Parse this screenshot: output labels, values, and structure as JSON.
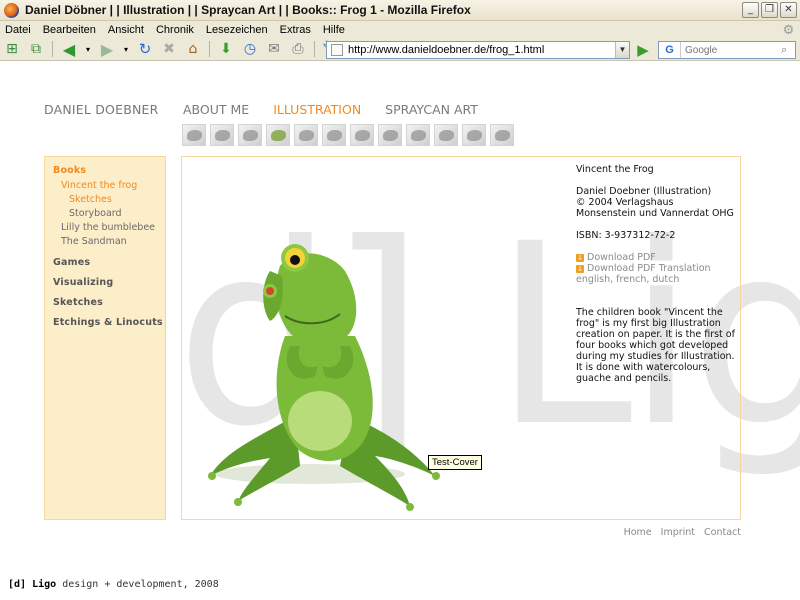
{
  "window": {
    "title": "Daniel Döbner | | Illustration | | Spraycan Art | | Books:: Frog 1 - Mozilla Firefox",
    "buttons": [
      "_",
      "❐",
      "✕"
    ]
  },
  "menu": [
    "Datei",
    "Bearbeiten",
    "Ansicht",
    "Chronik",
    "Lesezeichen",
    "Extras",
    "Hilfe"
  ],
  "toolbar": {
    "url": "http://www.danieldoebner.de/frog_1.html",
    "search_placeholder": "Google",
    "search_engine": "G"
  },
  "site": {
    "logo": "DANIEL DOEBNER",
    "nav": [
      {
        "label": "ABOUT ME",
        "active": false
      },
      {
        "label": "ILLUSTRATION",
        "active": true
      },
      {
        "label": "SPRAYCAN ART",
        "active": false
      }
    ],
    "watermark": "[d] Ligo"
  },
  "sidebar": {
    "books": "Books",
    "vincent": "Vincent the frog",
    "sketches": "Sketches",
    "storyboard": "Storyboard",
    "lilly": "Lilly the bumblebee",
    "sandman": "The Sandman",
    "games": "Games",
    "visualizing": "Visualizing",
    "sketches_section": "Sketches",
    "etchings": "Etchings & Linocuts"
  },
  "info": {
    "title": "Vincent the Frog",
    "author": "Daniel Doebner (Illustration)",
    "copyright": "© 2004 Verlagshaus Monsenstein und Vannerdat OHG",
    "isbn": "ISBN:  3-937312-72-2",
    "download_pdf": "Download PDF",
    "download_translation": "Download PDF Translation",
    "languages": "english, french, dutch",
    "description": "The children book \"Vincent the frog\" is my first big Illustration creation on paper. It is the first of four books which got developed during my studies for Illustration. It is done with watercolours, guache and pencils."
  },
  "tooltip": "Test-Cover",
  "footer": {
    "home": "Home",
    "imprint": "Imprint",
    "contact": "Contact",
    "credit_brand": "[d] Ligo",
    "credit_rest": " design + development, 2008"
  },
  "colors": {
    "accent": "#f08a1e",
    "sidebar_bg": "#fbeec9",
    "frame_border": "#f3d99b"
  }
}
